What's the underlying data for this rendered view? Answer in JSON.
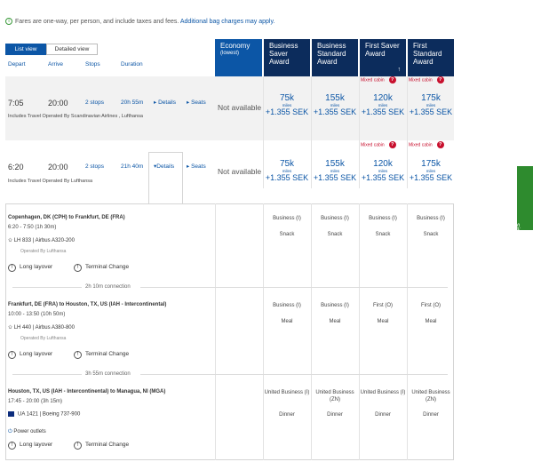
{
  "notice": {
    "text": "Fares are one-way, per person, and include taxes and fees.",
    "link": "Additional bag charges may apply."
  },
  "tabs": [
    "List view",
    "Detailed view"
  ],
  "columns": {
    "depart": "Depart",
    "arrive": "Arrive",
    "stops": "Stops",
    "duration": "Duration"
  },
  "cabins": [
    {
      "title": "Economy",
      "sub": "(lowest)"
    },
    {
      "title": "Business Saver Award",
      "sub": ""
    },
    {
      "title": "Business Standard Award",
      "sub": ""
    },
    {
      "title": "First Saver Award",
      "sub": "",
      "sort": "↑"
    },
    {
      "title": "First Standard Award",
      "sub": ""
    }
  ],
  "mixed_label": "Mixed cabin",
  "mixed_q": "?",
  "flights": [
    {
      "depart": "7:05",
      "arrive": "20:00",
      "stops": "2 stops",
      "duration": "20h 55m",
      "details": "Details",
      "seats": "Seats",
      "operated": "Includes Travel Operated By Scandinavian Airlines , Lufthansa",
      "economy": "Not available",
      "prices": [
        {
          "miles": "75k",
          "unit": "miles",
          "sek": "+1.355 SEK"
        },
        {
          "miles": "155k",
          "unit": "miles",
          "sek": "+1.355 SEK"
        },
        {
          "miles": "120k",
          "unit": "miles",
          "sek": "+1.355 SEK"
        },
        {
          "miles": "175k",
          "unit": "miles",
          "sek": "+1.355 SEK"
        }
      ]
    },
    {
      "depart": "6:20",
      "arrive": "20:00",
      "stops": "2 stops",
      "duration": "21h 40m",
      "details": "Details",
      "seats": "Seats",
      "operated": "Includes Travel Operated By Lufthansa",
      "economy": "Not available",
      "prices": [
        {
          "miles": "75k",
          "unit": "miles",
          "sek": "+1.355 SEK"
        },
        {
          "miles": "155k",
          "unit": "miles",
          "sek": "+1.355 SEK"
        },
        {
          "miles": "120k",
          "unit": "miles",
          "sek": "+1.355 SEK"
        },
        {
          "miles": "175k",
          "unit": "miles",
          "sek": "+1.355 SEK"
        }
      ]
    }
  ],
  "segments": [
    {
      "route": "Copenhagen, DK (CPH) to Frankfurt, DE (FRA)",
      "time": "6:20 - 7:50 (1h 30m)",
      "flight": "LH 833 | Airbus A320-200",
      "operated": "Operated By Lufthansa",
      "cabins": [
        "Business (I)",
        "Business (I)",
        "Business (I)",
        "Business (I)"
      ],
      "meals": [
        "Snack",
        "Snack",
        "Snack",
        "Snack"
      ],
      "warn1": "Long layover",
      "warn2": "Terminal Change"
    },
    {
      "route": "Frankfurt, DE (FRA) to Houston, TX, US (IAH - Intercontinental)",
      "time": "10:00 - 13:50 (10h 50m)",
      "flight": "LH 440 | Airbus A380-800",
      "operated": "Operated By Lufthansa",
      "cabins": [
        "Business (I)",
        "Business (I)",
        "First (O)",
        "First (O)"
      ],
      "meals": [
        "Meal",
        "Meal",
        "Meal",
        "Meal"
      ],
      "warn1": "Long layover",
      "warn2": "Terminal Change"
    },
    {
      "route": "Houston, TX, US (IAH - Intercontinental) to Managua, NI (MGA)",
      "time": "17:45 - 20:00 (3h 15m)",
      "flight": "UA 1421 | Boeing 737-900",
      "operated": "",
      "extra": "Power outlets",
      "cabins": [
        "United Business (I)",
        "United Business (ZN)",
        "United Business (I)",
        "United Business (ZN)"
      ],
      "meals": [
        "Dinner",
        "Dinner",
        "Dinner",
        "Dinner"
      ],
      "warn1": "Long layover",
      "warn2": "Terminal Change"
    }
  ],
  "connections": [
    "2h 10m connection",
    "3h 55m connection"
  ],
  "feedback": "Site Feedback"
}
